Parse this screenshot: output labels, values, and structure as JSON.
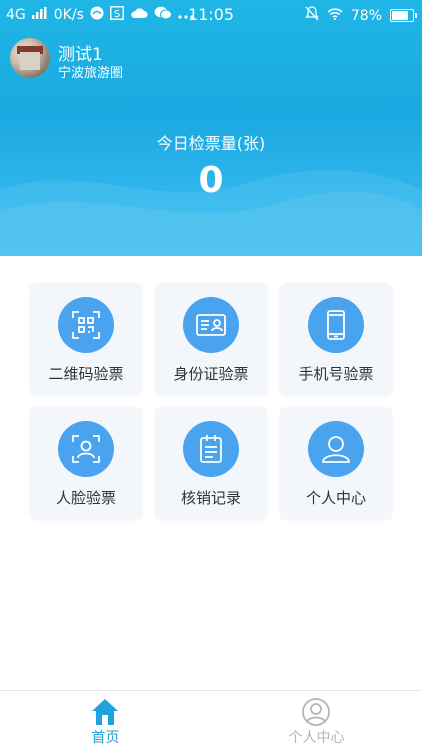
{
  "status_bar": {
    "network": "4G",
    "speed": "0K/s",
    "time": "11:05",
    "battery": "78%",
    "battery_level": 0.78
  },
  "user": {
    "name": "测试1",
    "org": "宁波旅游圈"
  },
  "stats": {
    "label": "今日检票量(张)",
    "value": "0"
  },
  "tiles": [
    {
      "label": "二维码验票",
      "icon": "qr-scan-icon"
    },
    {
      "label": "身份证验票",
      "icon": "id-card-icon"
    },
    {
      "label": "手机号验票",
      "icon": "phone-icon"
    },
    {
      "label": "人脸验票",
      "icon": "face-scan-icon"
    },
    {
      "label": "核销记录",
      "icon": "clipboard-icon"
    },
    {
      "label": "个人中心",
      "icon": "person-icon"
    }
  ],
  "tabbar": {
    "home": "首页",
    "profile": "个人中心"
  },
  "colors": {
    "header": "#1fb6e6",
    "tile_icon": "#4aa3ee",
    "tab_active": "#1fa3dc",
    "tab_inactive": "#b5b5b5"
  }
}
